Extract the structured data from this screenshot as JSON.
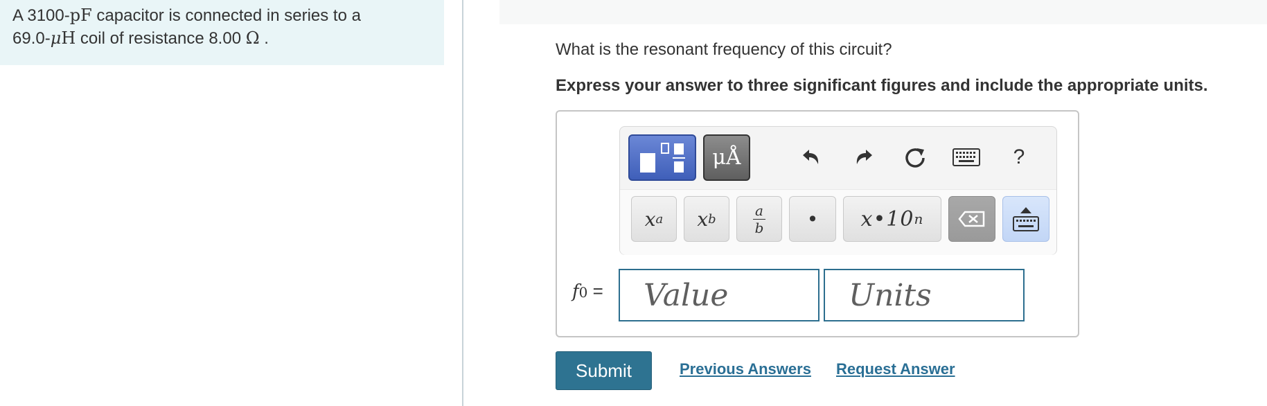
{
  "problem": {
    "line1_prefix": "A 3100-",
    "line1_unit": "pF",
    "line1_suffix": " capacitor is connected in series to a",
    "line2_prefix": "69.0-",
    "line2_mu": "μ",
    "line2_unit": "H",
    "line2_suffix": " coil of resistance 8.00 ",
    "line2_ohm": "Ω",
    "line2_end": " ."
  },
  "question": "What is the resonant frequency of this circuit?",
  "instruction": "Express your answer to three significant figures and include the appropriate units.",
  "toolbar": {
    "units_label": "μÅ",
    "help_label": "?",
    "icons": [
      "templates-icon",
      "units-icon",
      "undo-icon",
      "redo-icon",
      "reset-icon",
      "keyboard-icon",
      "help-icon"
    ]
  },
  "keys": {
    "sup_base": "x",
    "sup_exp": "a",
    "sub_base": "x",
    "sub_idx": "b",
    "frac_num": "a",
    "frac_den": "b",
    "dot": "•",
    "sci": "x•10",
    "sci_exp": "n"
  },
  "answer": {
    "label_var": "f",
    "label_sub": "0",
    "label_eq": " =",
    "value_placeholder": "Value",
    "units_placeholder": "Units"
  },
  "actions": {
    "submit": "Submit",
    "previous_answers": "Previous Answers",
    "request_answer": "Request Answer"
  },
  "colors": {
    "problem_bg": "#e9f5f7",
    "template_button": "#4a6bc4",
    "submit_button": "#2e7391",
    "link": "#2a6f95"
  }
}
